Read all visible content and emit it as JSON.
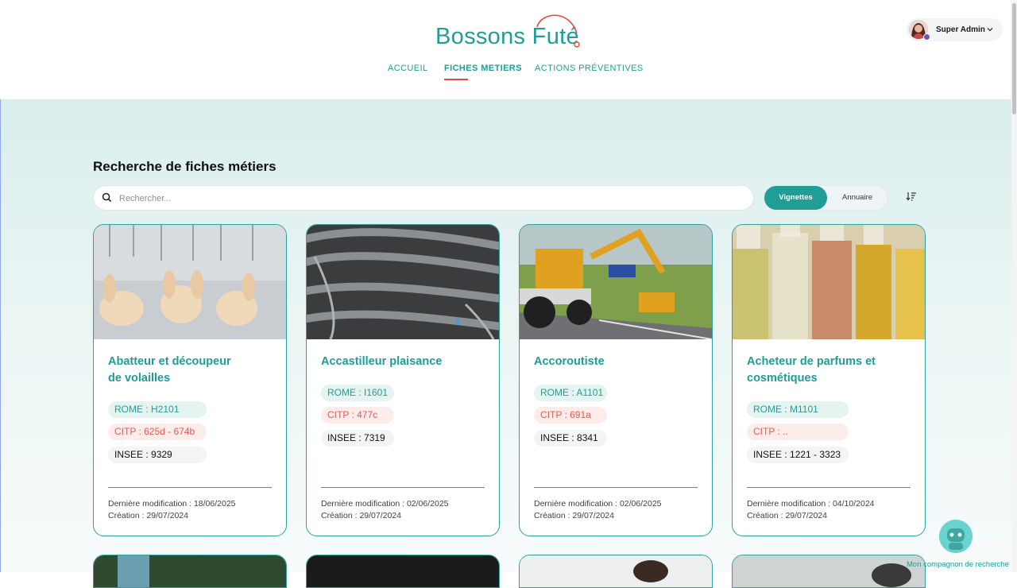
{
  "brand": {
    "name": "Bossons Futé",
    "accent": "#1e9e96",
    "highlight": "#e8473b"
  },
  "nav": {
    "items": [
      {
        "label": "ACCUEIL",
        "active": false
      },
      {
        "label": "FICHES METIERS",
        "active": true
      },
      {
        "label": "ACTIONS PRÉVENTIVES",
        "active": false
      }
    ]
  },
  "user": {
    "name": "Super Admin"
  },
  "page": {
    "title": "Recherche de fiches métiers",
    "search_placeholder": "Rechercher...",
    "view_toggle": {
      "cards_label": "Vignettes",
      "list_label": "Annuaire",
      "selected": "Vignettes"
    }
  },
  "cards": [
    {
      "title_line1": "Abatteur et découpeur",
      "title_line2": "de volailles",
      "rome": "ROME : H2101",
      "citp": "CITP : 625d - 674b",
      "insee": "INSEE : 9329",
      "modified": "Dernière modification : 18/06/2025",
      "created": "Création : 29/07/2024"
    },
    {
      "title_line1": "Accastilleur plaisance",
      "title_line2": "",
      "rome": "ROME : I1601",
      "citp": "CITP : 477c",
      "insee": "INSEE : 7319",
      "modified": "Dernière modification : 02/06/2025",
      "created": "Création : 29/07/2024"
    },
    {
      "title_line1": "Accoroutiste",
      "title_line2": "",
      "rome": "ROME : A1101",
      "citp": "CITP : 691a",
      "insee": "INSEE : 8341",
      "modified": "Dernière modification : 02/06/2025",
      "created": "Création : 29/07/2024"
    },
    {
      "title_line1": "Acheteur de parfums et",
      "title_line2": "cosmétiques",
      "rome": "ROME : M1101",
      "citp": "CITP : ..",
      "insee": "INSEE : 1221 - 3323",
      "modified": "Dernière modification : 04/10/2024",
      "created": "Création : 29/07/2024"
    }
  ],
  "assistant": {
    "label": "Mon compagnon de recherche"
  }
}
